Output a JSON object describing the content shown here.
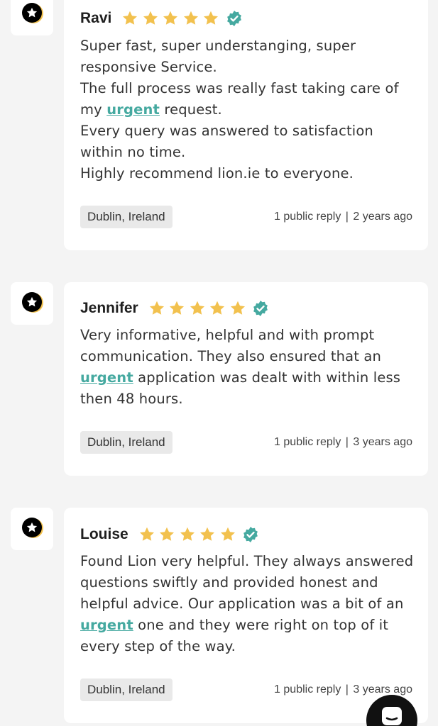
{
  "reviews": [
    {
      "name": "Ravi",
      "rating": 5,
      "verified": true,
      "body": [
        [
          "Super fast, super understanging, super responsive Service."
        ],
        [
          "The full process was really fast taking care of my ",
          {
            "link": "urgent"
          },
          " request."
        ],
        [
          "Every query was answered to satisfaction within no time."
        ],
        [
          "Highly recommend lion.ie to everyone."
        ]
      ],
      "location": "Dublin, Ireland",
      "replies": "1 public reply",
      "age": "2 years ago"
    },
    {
      "name": "Jennifer",
      "rating": 5,
      "verified": true,
      "body": [
        [
          "Very informative, helpful and with prompt communication. They also ensured that an ",
          {
            "link": "urgent"
          },
          " application was dealt with within less then 48 hours."
        ]
      ],
      "location": "Dublin, Ireland",
      "replies": "1 public reply",
      "age": "3 years ago"
    },
    {
      "name": "Louise",
      "rating": 5,
      "verified": true,
      "body": [
        [
          "Found Lion very helpful. They always answered questions swiftly and provided honest and helpful advice. Our application was a bit of an ",
          {
            "link": "urgent"
          },
          " one and they were right on top of it every step of the way."
        ]
      ],
      "location": "Dublin, Ireland",
      "replies": "1 public reply",
      "age": "3 years ago"
    }
  ],
  "colors": {
    "star": "#f2c14e",
    "verified": "#45a9a0",
    "link": "#45a9a0",
    "card": "#ffffff",
    "background": "#f4f4f4"
  },
  "icons": {
    "avatar": "star-badge-icon",
    "rating": "star-icon",
    "verified": "verified-check-icon",
    "chat": "chat-icon"
  }
}
